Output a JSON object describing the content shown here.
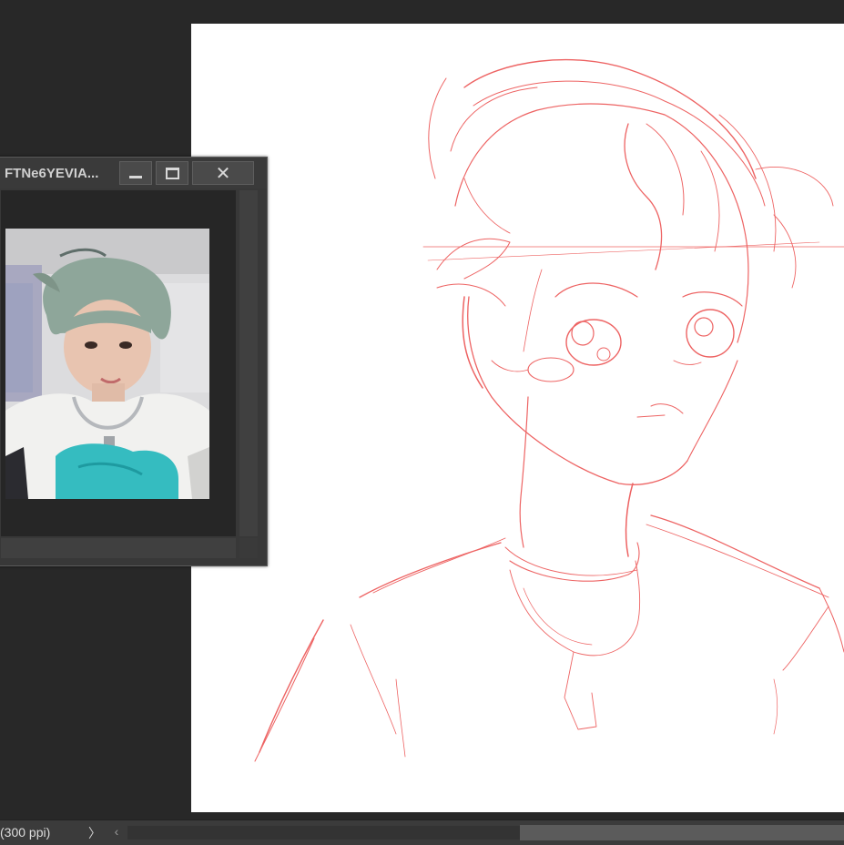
{
  "reference_window": {
    "title": "FTNe6YEVIA...",
    "minimize_icon": "minimize-icon",
    "maximize_icon": "maximize-icon",
    "close_icon": "close-icon",
    "close_glyph": "✕"
  },
  "status_bar": {
    "zoom_text": "(300 ppi)",
    "menu_arrow": "〉",
    "scroll_left_arrow": "‹"
  },
  "colors": {
    "workspace": "#282828",
    "sketch_stroke": "#e8302f",
    "panel": "#383838"
  }
}
